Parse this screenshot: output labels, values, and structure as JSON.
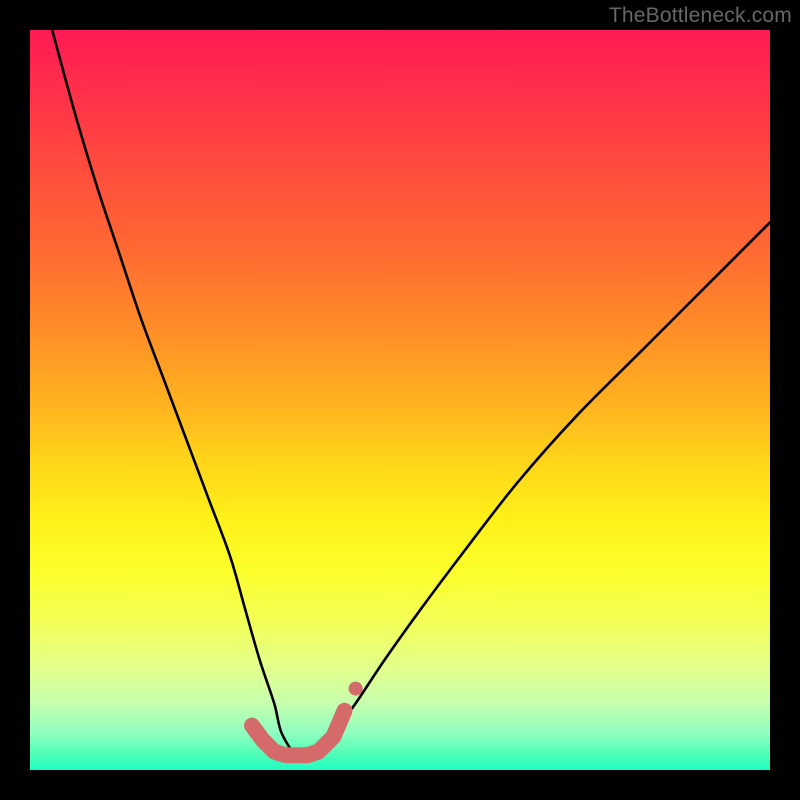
{
  "watermark": "TheBottleneck.com",
  "chart_data": {
    "type": "line",
    "title": "",
    "xlabel": "",
    "ylabel": "",
    "xlim": [
      0,
      100
    ],
    "ylim": [
      0,
      100
    ],
    "grid": false,
    "series": [
      {
        "name": "bottleneck-curve",
        "color": "#000000",
        "x": [
          3,
          6,
          9,
          12,
          15,
          18,
          21,
          24,
          27,
          29,
          31,
          33,
          34,
          36,
          38,
          41,
          44,
          48,
          53,
          59,
          66,
          74,
          83,
          92,
          100
        ],
        "values": [
          100,
          89,
          79,
          70,
          61,
          53,
          45,
          37,
          29,
          22,
          15,
          9,
          5,
          2,
          2,
          5,
          9,
          15,
          22,
          30,
          39,
          48,
          57,
          66,
          74
        ]
      }
    ],
    "markers": {
      "name": "flat-region-markers",
      "color": "#d46a6a",
      "style": "thick-dots",
      "x": [
        30,
        31.5,
        33,
        34.5,
        36,
        37.5,
        39,
        41,
        42.5
      ],
      "values": [
        6,
        4,
        2.5,
        2,
        2,
        2,
        2.5,
        4.5,
        8
      ]
    }
  }
}
